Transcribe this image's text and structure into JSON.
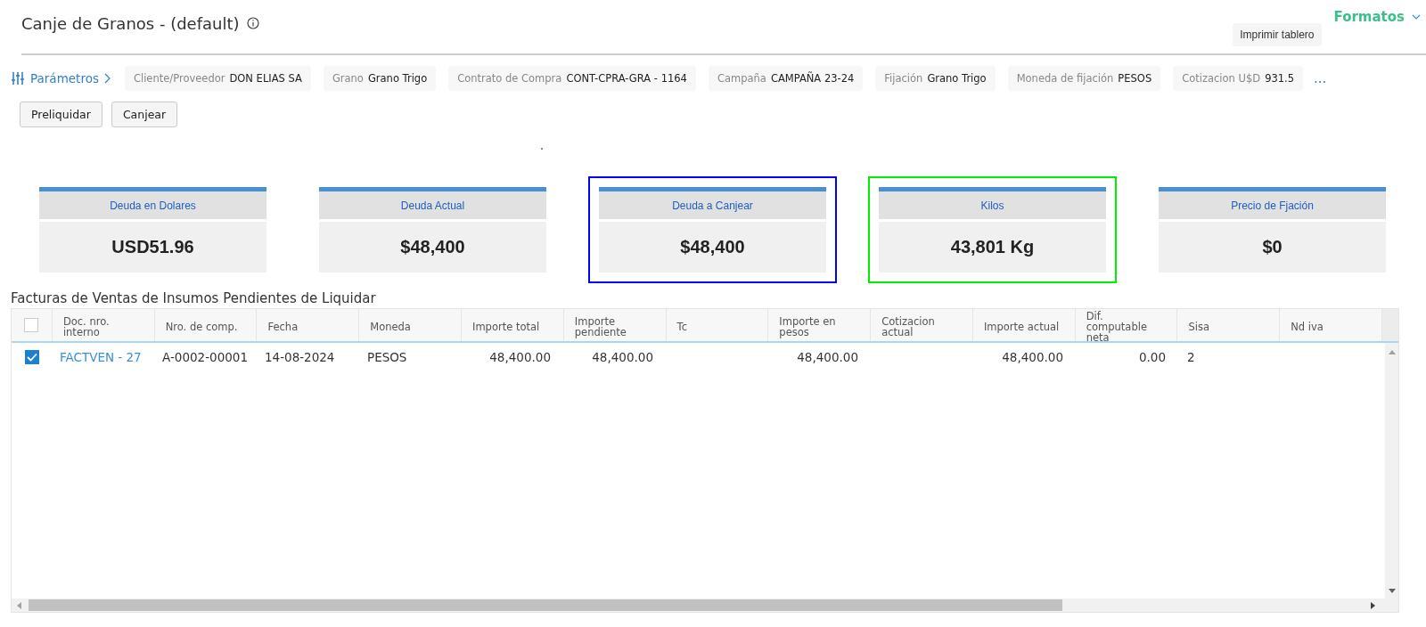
{
  "header": {
    "title": "Canje de Granos - (default)",
    "print_button": "Imprimir tablero",
    "formats_menu": "Formatos"
  },
  "parameters": {
    "label": "Parámetros",
    "more": "...",
    "chips": [
      {
        "label": "Cliente/Proveedor",
        "value": "DON ELIAS SA"
      },
      {
        "label": "Grano",
        "value": "Grano Trigo"
      },
      {
        "label": "Contrato de Compra",
        "value": "CONT-CPRA-GRA - 1164"
      },
      {
        "label": "Campaña",
        "value": "CAMPAÑA 23-24"
      },
      {
        "label": "Fijación",
        "value": "Grano Trigo"
      },
      {
        "label": "Moneda de fijación",
        "value": "PESOS"
      },
      {
        "label": "Cotizacion U$D",
        "value": "931.5"
      }
    ]
  },
  "actions": [
    "Preliquidar",
    "Canjear"
  ],
  "cards": [
    {
      "title": "Deuda en Dolares",
      "value": "USD51.96"
    },
    {
      "title": "Deuda Actual",
      "value": "$48,400"
    },
    {
      "title": "Deuda a Canjear",
      "value": "$48,400",
      "color": "#0000ff"
    },
    {
      "title": "Kilos",
      "value": "43,801 Kg",
      "color": "#00ee00"
    },
    {
      "title": "Precio de Fjación",
      "value": "$0"
    }
  ],
  "table": {
    "title": "Facturas de Ventas de Insumos Pendientes de Liquidar",
    "all_checked": false,
    "columns": [
      "Doc. nro. interno",
      "Nro. de comp.",
      "Fecha",
      "Moneda",
      "Importe total",
      "Importe pendiente",
      "Tc",
      "Importe en pesos",
      "Cotizacion actual",
      "Importe actual",
      "Dif. computable neta",
      "Sisa",
      "Nd iva"
    ],
    "rows": [
      {
        "checked": true,
        "cells": [
          "FACTVEN - 27",
          "A-0002-00001",
          "14-08-2024",
          "PESOS",
          "48,400.00",
          "48,400.00",
          "",
          "48,400.00",
          "",
          "48,400.00",
          "0.00",
          "2",
          ""
        ]
      }
    ]
  }
}
